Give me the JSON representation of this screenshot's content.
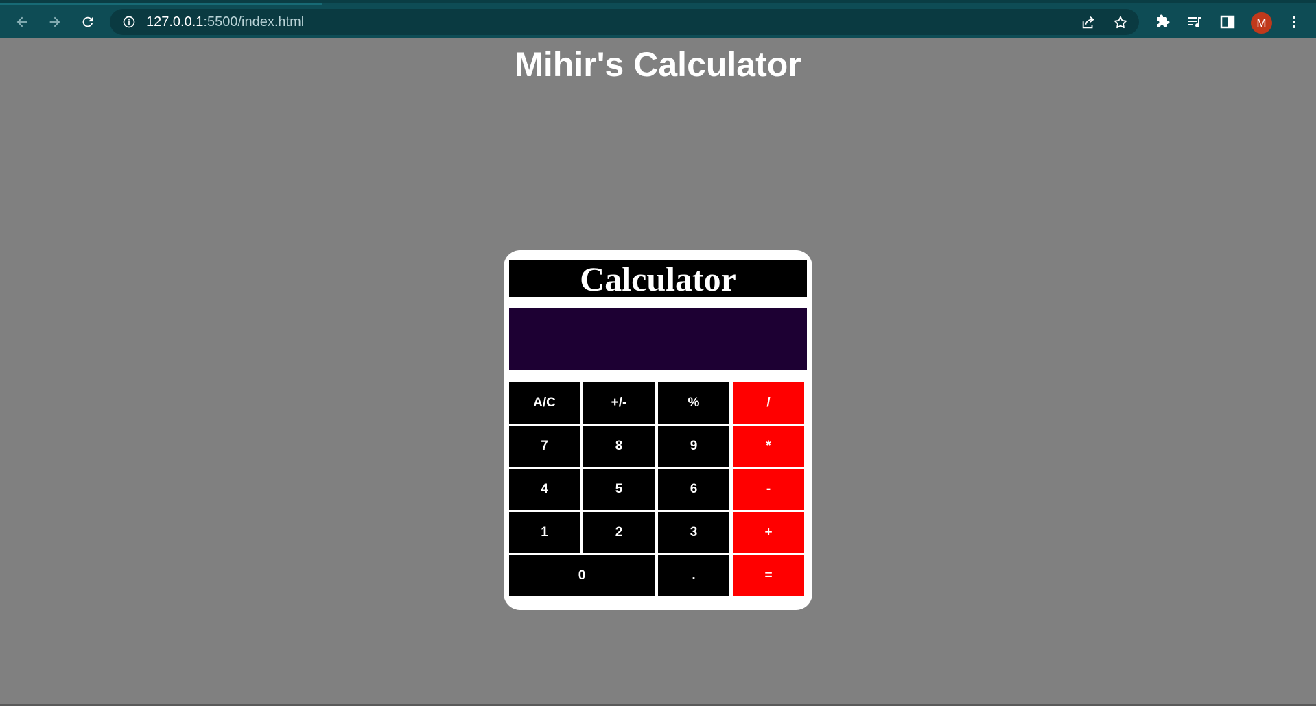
{
  "browser": {
    "url_host": "127.0.0.1",
    "url_path": ":5500/index.html",
    "avatar_letter": "M",
    "colors": {
      "toolbar": "#0e4c55",
      "avatar": "#c0391b"
    }
  },
  "page": {
    "title": "Mihir's Calculator",
    "background": "#808080"
  },
  "calculator": {
    "heading": "Calculator",
    "display_value": "",
    "keys": {
      "ac": "A/C",
      "sign": "+/-",
      "percent": "%",
      "divide": "/",
      "seven": "7",
      "eight": "8",
      "nine": "9",
      "multiply": "*",
      "four": "4",
      "five": "5",
      "six": "6",
      "minus": "-",
      "one": "1",
      "two": "2",
      "three": "3",
      "plus": "+",
      "zero": "0",
      "dot": ".",
      "equals": "="
    },
    "colors": {
      "key": "#000000",
      "operator": "#ff0000",
      "display": "#1d0033"
    }
  }
}
